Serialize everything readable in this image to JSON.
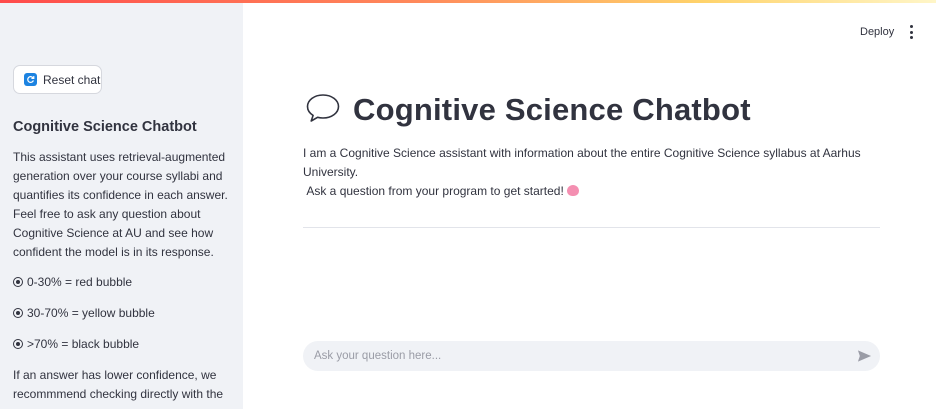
{
  "sidebar": {
    "reset_label": "Reset chat",
    "title": "Cognitive Science Chatbot",
    "desc_lines": [
      "This assistant uses retrieval-augmented",
      "generation over your course syllabi and",
      "quantifies its confidence in each answer.",
      "Feel free to ask any question about",
      "Cognitive Science at AU and see how",
      "confident the model is in its response."
    ],
    "legend": [
      "0-30% = red bubble",
      "30-70% = yellow bubble",
      ">70% = black bubble"
    ],
    "note_lines": [
      "If an answer has lower confidence, we",
      "recommmend checking directly with the"
    ]
  },
  "header": {
    "deploy_label": "Deploy",
    "menu_icon": "kebab-menu-icon"
  },
  "main": {
    "title": "Cognitive Science Chatbot",
    "title_icon": "speech-bubble-icon",
    "intro_line1": "I am a Cognitive Science assistant with information about the entire Cognitive Science syllabus at Aarhus University.",
    "intro_line2": "Ask a question from your program to get started!",
    "intro_emoji": "brain-icon"
  },
  "chat": {
    "placeholder": "Ask your question here...",
    "send_icon": "send-icon"
  },
  "colors": {
    "sidebar_bg": "#f0f2f6",
    "accent": "#ff4b4b",
    "text": "#31333f"
  }
}
